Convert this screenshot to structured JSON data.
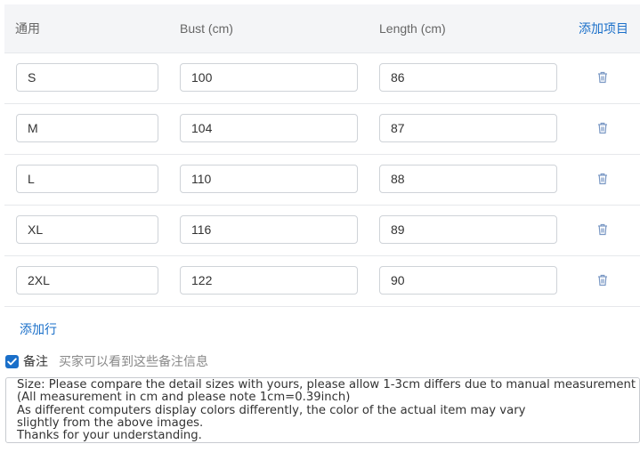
{
  "header": {
    "col_label": "通用",
    "col_bust": "Bust (cm)",
    "col_length": "Length (cm)",
    "add_item": "添加项目"
  },
  "rows": [
    {
      "size": "S",
      "bust": "100",
      "length": "86"
    },
    {
      "size": "M",
      "bust": "104",
      "length": "87"
    },
    {
      "size": "L",
      "bust": "110",
      "length": "88"
    },
    {
      "size": "XL",
      "bust": "116",
      "length": "89"
    },
    {
      "size": "2XL",
      "bust": "122",
      "length": "90"
    }
  ],
  "add_row": "添加行",
  "remark": {
    "label": "备注",
    "checked": true,
    "hint": "买家可以看到这些备注信息"
  },
  "notes": "Size: Please compare the detail sizes with yours, please allow 1-3cm differs due to manual measurement\n(All measurement in cm and please note 1cm=0.39inch)\nAs different computers display colors differently, the color of the actual item may vary\nslightly from the above images.\nThanks for your understanding.",
  "icons": {
    "delete": "trash-icon",
    "checkbox": "checkmark-icon"
  },
  "colors": {
    "accent": "#1a6fc9",
    "header_bg": "#f4f5f7",
    "delete_icon": "#7a98c4"
  }
}
